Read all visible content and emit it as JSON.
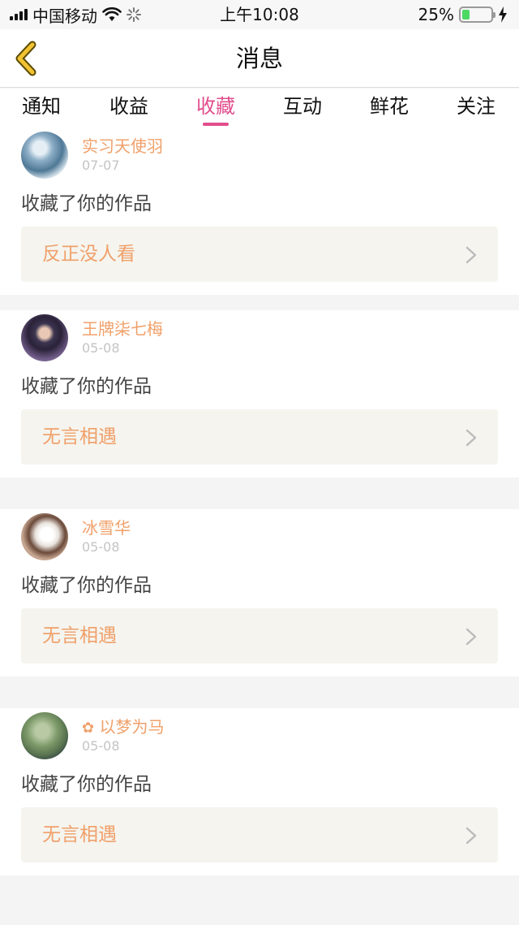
{
  "status_bar": {
    "carrier": "中国移动",
    "time": "上午10:08",
    "battery": "25%",
    "battery_level": 0.25,
    "icons": [
      "signal-icon",
      "wifi-icon",
      "loading-icon",
      "battery-icon",
      "charging-icon"
    ]
  },
  "nav": {
    "title": "消息",
    "back_icon": "chevron-left-icon"
  },
  "tabs": [
    {
      "label": "通知",
      "active": false
    },
    {
      "label": "收益",
      "active": false
    },
    {
      "label": "收藏",
      "active": true
    },
    {
      "label": "互动",
      "active": false
    },
    {
      "label": "鲜花",
      "active": false
    },
    {
      "label": "关注",
      "active": false
    }
  ],
  "colors": {
    "accent": "#e24d8c",
    "name": "#f0a06a",
    "work_bg": "#f5f4ee",
    "date": "#c4c4c4"
  },
  "items": [
    {
      "user": "实习天使羽",
      "date": "07-07",
      "action": "收藏了你的作品",
      "work": "反正没人看"
    },
    {
      "user": "王牌柒七梅",
      "date": "05-08",
      "action": "收藏了你的作品",
      "work": "无言相遇"
    },
    {
      "user": "冰雪华",
      "date": "05-08",
      "action": "收藏了你的作品",
      "work": "无言相遇"
    },
    {
      "user": "以梦为马",
      "user_prefix_icon": "flower-icon",
      "date": "05-08",
      "action": "收藏了你的作品",
      "work": "无言相遇"
    }
  ]
}
